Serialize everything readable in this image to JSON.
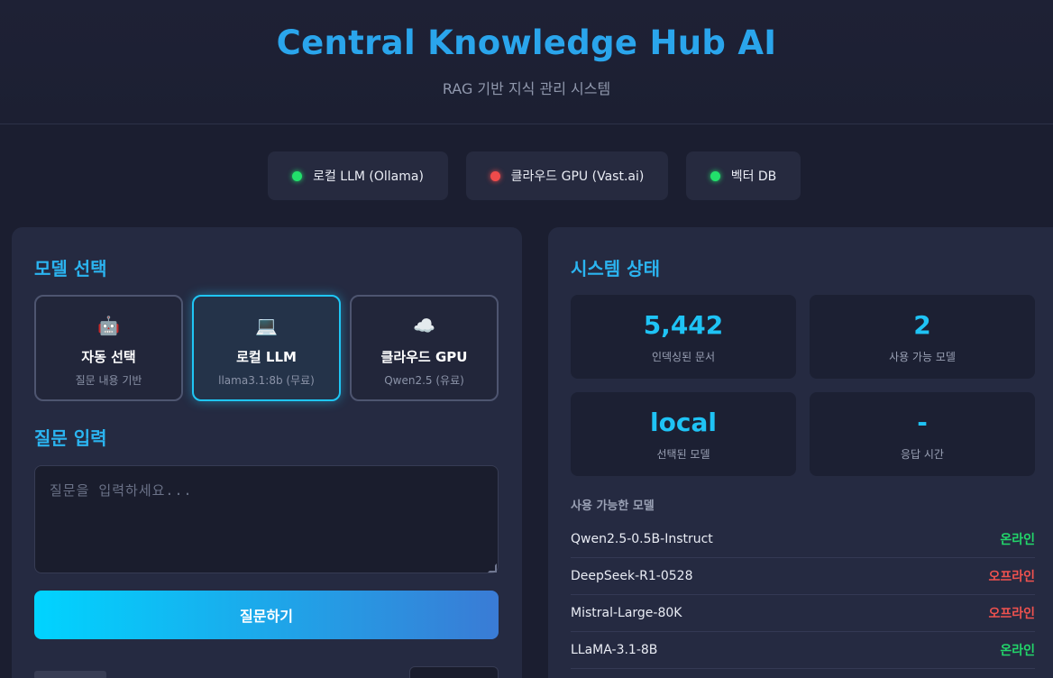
{
  "header": {
    "title": "Central Knowledge Hub AI",
    "subtitle": "RAG 기반 지식 관리 시스템"
  },
  "status": [
    {
      "label": "로컬 LLM (Ollama)",
      "state": "online",
      "color": "#22e06b"
    },
    {
      "label": "클라우드 GPU (Vast.ai)",
      "state": "offline",
      "color": "#ef4b4b"
    },
    {
      "label": "벡터 DB",
      "state": "online",
      "color": "#22e06b"
    }
  ],
  "model_select": {
    "title": "모델 선택",
    "options": [
      {
        "icon": "robot-icon",
        "glyph": "🤖",
        "name": "자동 선택",
        "desc": "질문 내용 기반",
        "selected": false
      },
      {
        "icon": "laptop-icon",
        "glyph": "💻",
        "name": "로컬 LLM",
        "desc": "llama3.1:8b (무료)",
        "selected": true
      },
      {
        "icon": "cloud-icon",
        "glyph": "☁️",
        "name": "클라우드 GPU",
        "desc": "Qwen2.5 (유료)",
        "selected": false
      }
    ]
  },
  "question": {
    "title": "질문 입력",
    "placeholder": "질문을 입력하세요...",
    "value": "",
    "submit_label": "질문하기"
  },
  "system_status": {
    "title": "시스템 상태",
    "stats": [
      {
        "value": "5,442",
        "label": "인덱싱된 문서"
      },
      {
        "value": "2",
        "label": "사용 가능 모델"
      },
      {
        "value": "local",
        "label": "선택된 모델"
      },
      {
        "value": "-",
        "label": "응답 시간"
      }
    ],
    "available_title": "사용 가능한 모델",
    "models": [
      {
        "name": "Qwen2.5-0.5B-Instruct",
        "status": "온라인",
        "color": "#22d66a"
      },
      {
        "name": "DeepSeek-R1-0528",
        "status": "오프라인",
        "color": "#f0524f"
      },
      {
        "name": "Mistral-Large-80K",
        "status": "오프라인",
        "color": "#f0524f"
      },
      {
        "name": "LLaMA-3.1-8B",
        "status": "온라인",
        "color": "#22d66a"
      }
    ]
  },
  "colors": {
    "accent": "#2aa5ec",
    "online": "#22e06b",
    "offline": "#ef4b4b"
  }
}
